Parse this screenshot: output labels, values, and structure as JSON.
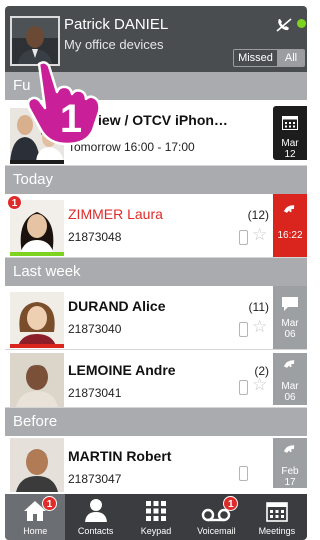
{
  "header": {
    "user_name": "Patrick DANIEL",
    "subtitle": "My office devices",
    "filter_missed": "Missed",
    "filter_all": "All",
    "status_color": "#7ed321"
  },
  "overlay": {
    "step_number": "1"
  },
  "sections": {
    "future": "Fu",
    "today": "Today",
    "last_week": "Last week",
    "before": "Before"
  },
  "rows": [
    {
      "name": "review / OTCV iPhon…",
      "time": "Tomorrow 16:00 - 17:00",
      "tag_icon": "calendar-icon",
      "tag_line1": "Mar",
      "tag_line2": "12"
    },
    {
      "name": "ZIMMER Laura",
      "number": "21873048",
      "count": "(12)",
      "badge": "1",
      "tag_icon": "phone-icon",
      "tag_line1": "16:22",
      "missed": true
    },
    {
      "name": "DURAND Alice",
      "number": "21873040",
      "count": "(11)",
      "tag_icon": "message-icon",
      "tag_line1": "Mar",
      "tag_line2": "06"
    },
    {
      "name": "LEMOINE Andre",
      "number": "21873041",
      "count": "(2)",
      "tag_icon": "phone-icon",
      "tag_line1": "Mar",
      "tag_line2": "06"
    },
    {
      "name": "MARTIN Robert",
      "number": "21873047",
      "tag_icon": "phone-icon",
      "tag_line1": "Feb",
      "tag_line2": "17"
    }
  ],
  "nav": [
    {
      "label": "Home",
      "icon": "home-icon",
      "badge": "1",
      "active": true
    },
    {
      "label": "Contacts",
      "icon": "contacts-icon"
    },
    {
      "label": "Keypad",
      "icon": "keypad-icon"
    },
    {
      "label": "Voicemail",
      "icon": "voicemail-icon",
      "badge": "1"
    },
    {
      "label": "Meetings",
      "icon": "meetings-icon"
    }
  ]
}
